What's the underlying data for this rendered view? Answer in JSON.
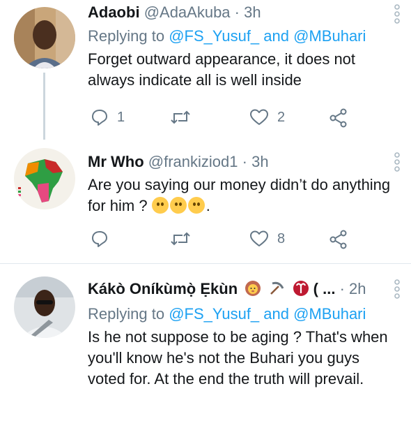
{
  "tweets": [
    {
      "name": "Adaobi",
      "handle": "@AdaAkuba",
      "separator": "·",
      "time": "3h",
      "replying_prefix": "Replying to",
      "reply_mention_1": "@FS_Yusuf_",
      "reply_and": "and",
      "reply_mention_2": "@MBuhari",
      "text": "Forget outward appearance, it does not always indicate all is well inside",
      "reply_count": "1",
      "retweet_count": "",
      "like_count": "2"
    },
    {
      "name": "Mr Who",
      "handle": "@frankiziod1",
      "separator": "·",
      "time": "3h",
      "text": "Are you saying our money didn’t do anything for him ?",
      "text_suffix": ".",
      "reply_count": "",
      "retweet_count": "",
      "like_count": "8"
    },
    {
      "name": "Kákò Oníkùmọ̀ Ẹkùn",
      "name_suffix": "( ...",
      "separator": "·",
      "time": "2h",
      "replying_prefix": "Replying to",
      "reply_mention_1": "@FS_Yusuf_",
      "reply_and": "and",
      "reply_mention_2": "@MBuhari",
      "text": "Is he not suppose to be aging ? That's when you'll know he's not the Buhari you guys voted for. At the end the truth will prevail."
    }
  ],
  "colors": {
    "accent": "#1da1f2",
    "muted": "#657786",
    "text": "#14171a",
    "divider": "#e1e8ed"
  },
  "icons": {
    "reply": "reply-icon",
    "retweet": "retweet-icon",
    "like": "heart-icon",
    "share": "share-icon",
    "more": "more-vertical-icon"
  }
}
